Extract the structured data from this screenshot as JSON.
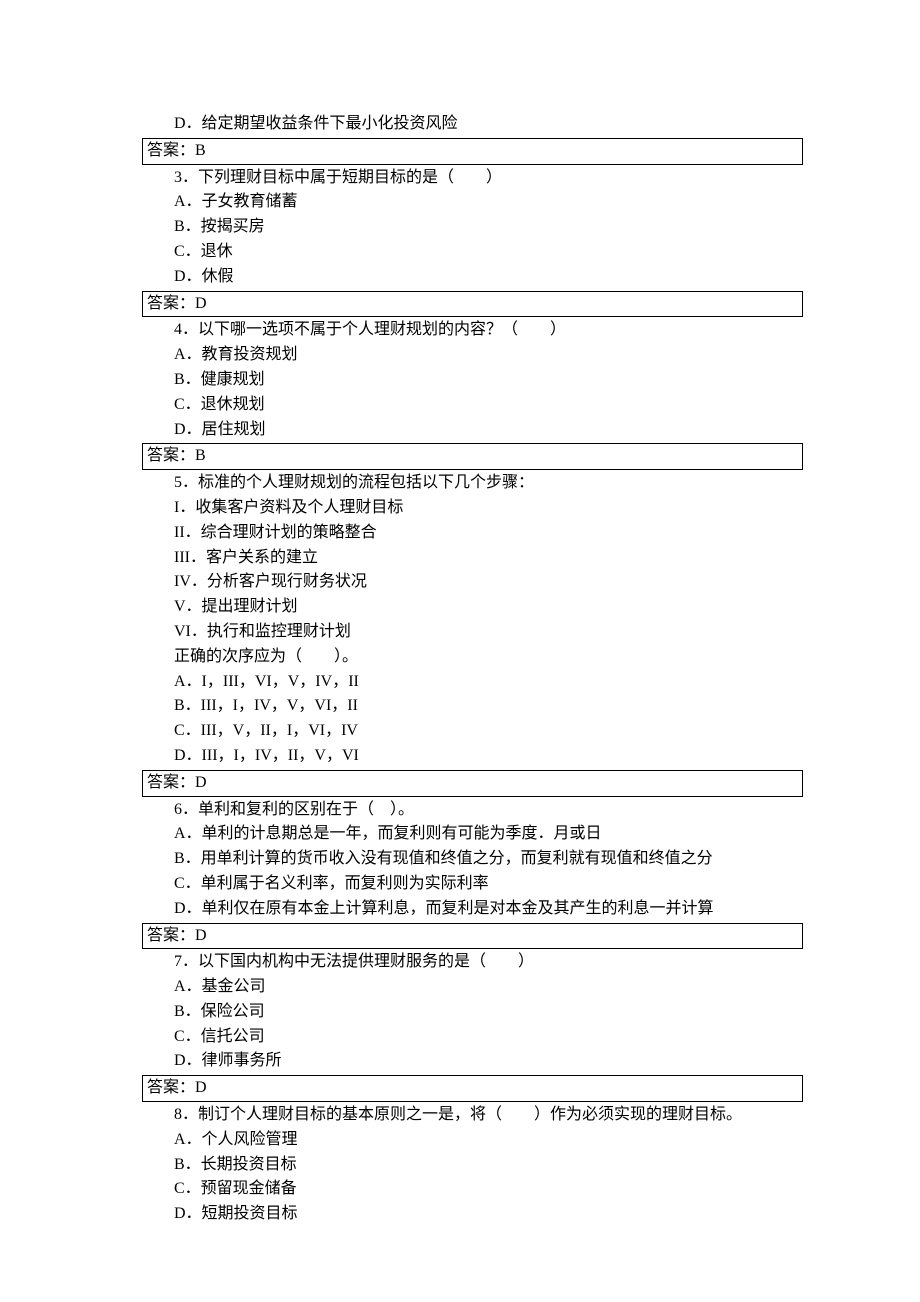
{
  "lines": {
    "l0": "D．给定期望收益条件下最小化投资风险",
    "a2": "答案：B",
    "q3": "3．下列理财目标中属于短期目标的是（　　）",
    "q3a": "A．子女教育储蓄",
    "q3b": "B．按揭买房",
    "q3c": "C．退休",
    "q3d": "D．休假",
    "a3": "答案：D",
    "q4": "4．以下哪一选项不属于个人理财规划的内容？（　　）",
    "q4a": "A．教育投资规划",
    "q4b": "B．健康规划",
    "q4c": "C．退休规划",
    "q4d": "D．居住规划",
    "a4": "答案：B",
    "q5": "5．标准的个人理财规划的流程包括以下几个步骤：",
    "q5s1": "I．收集客户资料及个人理财目标",
    "q5s2": "II．综合理财计划的策略整合",
    "q5s3": "III．客户关系的建立",
    "q5s4": "IV．分析客户现行财务状况",
    "q5s5": "V．提出理财计划",
    "q5s6": "VI．执行和监控理财计划",
    "q5p": "正确的次序应为（　　）。",
    "q5a": "A．I，III，VI，V，IV，II",
    "q5b": "B．III，I，IV，V，VI，II",
    "q5c": "C．III，V，II，I，VI，IV",
    "q5d": "D．III，I，IV，II，V，VI",
    "a5": "答案：D",
    "q6": "6．单利和复利的区别在于（　）。",
    "q6a": "A．单利的计息期总是一年，而复利则有可能为季度．月或日",
    "q6b": "B．用单利计算的货币收入没有现值和终值之分，而复利就有现值和终值之分",
    "q6c": "C．单利属于名义利率，而复利则为实际利率",
    "q6d": "D．单利仅在原有本金上计算利息，而复利是对本金及其产生的利息一并计算",
    "a6": "答案：D",
    "q7": "7．以下国内机构中无法提供理财服务的是（　　）",
    "q7a": "A．基金公司",
    "q7b": "B．保险公司",
    "q7c": "C．信托公司",
    "q7d": "D．律师事务所",
    "a7": "答案：D",
    "q8": "8．制订个人理财目标的基本原则之一是，将（　　）作为必须实现的理财目标。",
    "q8a": "A．个人风险管理",
    "q8b": "B．长期投资目标",
    "q8c": "C．预留现金储备",
    "q8d": "D．短期投资目标"
  }
}
